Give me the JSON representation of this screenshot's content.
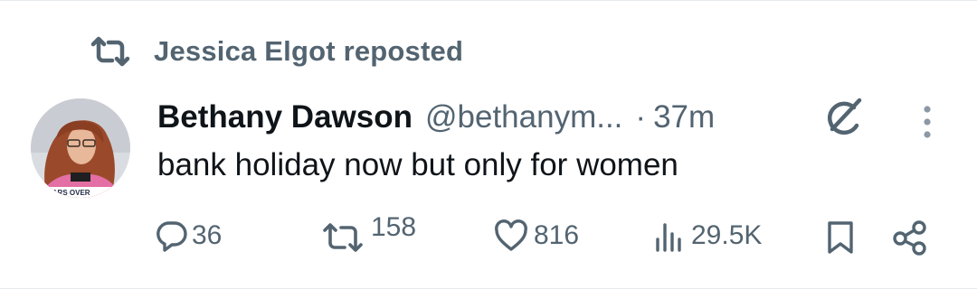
{
  "repost_banner": {
    "icon": "repost-icon",
    "text": "Jessica Elgot reposted"
  },
  "tweet": {
    "avatar": {
      "icon": "profile-photo",
      "caption": "S FEARS OVER"
    },
    "author_name": "Bethany Dawson",
    "handle": "@bethanym...",
    "separator": "·",
    "time": "37m",
    "grok_icon": "grok-icon",
    "more_icon": "more-vertical-icon",
    "text": "bank holiday now but only for women"
  },
  "actions": {
    "replies": "36",
    "reposts": "158",
    "likes": "816",
    "views": "29.5K",
    "bookmark_icon": "bookmark-icon",
    "share_icon": "share-icon"
  },
  "colors": {
    "text_primary": "#0f1419",
    "text_secondary": "#536471",
    "divider": "#e6e9ec"
  }
}
